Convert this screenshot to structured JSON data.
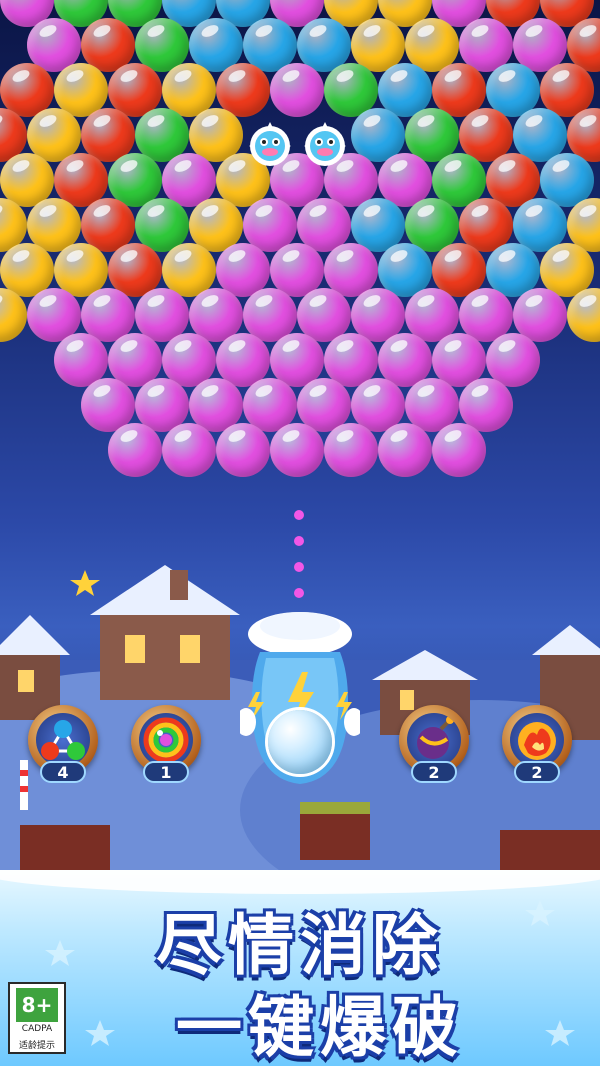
{
  "palette": {
    "green": "#2fc93a",
    "blue": "#27a6e8",
    "yellow": "#ffc21a",
    "red": "#ee3a1c",
    "magenta": "#e24fe0"
  },
  "bubble_grid": [
    [
      "magenta",
      "green",
      "green",
      "blue",
      "blue",
      "magenta",
      "yellow",
      "yellow",
      "magenta",
      "red",
      "red"
    ],
    [
      "magenta",
      "red",
      "green",
      "blue",
      "blue",
      "blue",
      "yellow",
      "yellow",
      "magenta",
      "magenta",
      "red"
    ],
    [
      "red",
      "yellow",
      "red",
      "yellow",
      "red",
      "magenta",
      "green",
      "blue",
      "red",
      "blue",
      "red"
    ],
    [
      "red",
      "yellow",
      "red",
      "green",
      "yellow",
      "",
      "",
      "blue",
      "green",
      "red",
      "blue",
      "red"
    ],
    [
      "yellow",
      "red",
      "green",
      "magenta",
      "yellow",
      "magenta",
      "magenta",
      "magenta",
      "green",
      "red",
      "blue"
    ],
    [
      "yellow",
      "yellow",
      "red",
      "green",
      "yellow",
      "magenta",
      "magenta",
      "blue",
      "green",
      "red",
      "blue",
      "yellow"
    ],
    [
      "yellow",
      "yellow",
      "red",
      "yellow",
      "magenta",
      "magenta",
      "magenta",
      "blue",
      "red",
      "blue",
      "yellow"
    ],
    [
      "yellow",
      "magenta",
      "magenta",
      "magenta",
      "magenta",
      "magenta",
      "magenta",
      "magenta",
      "magenta",
      "magenta",
      "magenta",
      "yellow"
    ],
    [
      "",
      "magenta",
      "magenta",
      "magenta",
      "magenta",
      "magenta",
      "magenta",
      "magenta",
      "magenta",
      "magenta",
      ""
    ],
    [
      "",
      "magenta",
      "magenta",
      "magenta",
      "magenta",
      "magenta",
      "magenta",
      "magenta",
      "magenta",
      "",
      ""
    ],
    [
      "",
      "",
      "magenta",
      "magenta",
      "magenta",
      "magenta",
      "magenta",
      "magenta",
      "magenta",
      "",
      ""
    ]
  ],
  "enemies": [
    "pufferfish-monster",
    "pufferfish-monster"
  ],
  "aim_dots": 5,
  "current_bubble": "light-blue",
  "boosters": [
    {
      "name": "triple-bubble-booster",
      "count": "4"
    },
    {
      "name": "rainbow-bubble-booster",
      "count": "1"
    },
    {
      "name": "bomb-booster",
      "count": "2"
    },
    {
      "name": "fireball-booster",
      "count": "2"
    }
  ],
  "slogan": {
    "line1": "尽情消除",
    "line2": "一键爆破"
  },
  "age_rating": {
    "age": "8+",
    "org": "CADPA",
    "tip": "适龄提示"
  }
}
